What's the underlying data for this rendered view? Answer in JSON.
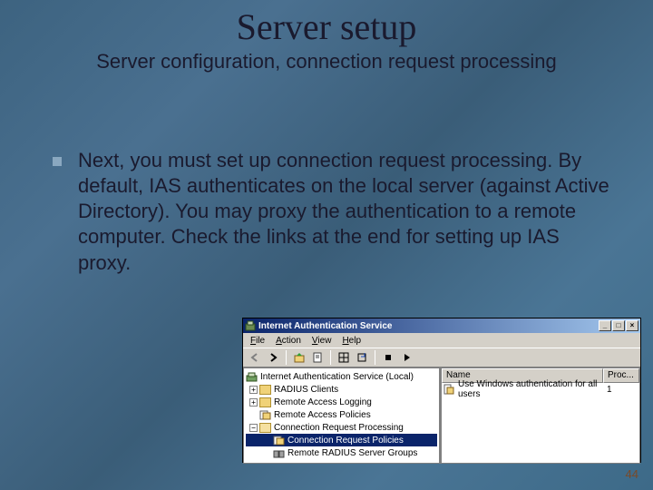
{
  "title": "Server setup",
  "subtitle": "Server configuration, connection request processing",
  "body_text": "Next, you must set up connection request processing. By default, IAS authenticates on the local server (against Active Directory). You may proxy the authentication to a remote computer. Check the links at the end for setting up IAS proxy.",
  "page_number": "44",
  "ias_window": {
    "title": "Internet Authentication Service",
    "menu": {
      "file": "File",
      "action": "Action",
      "view": "View",
      "help": "Help"
    },
    "tree": {
      "root": "Internet Authentication Service (Local)",
      "items": [
        "RADIUS Clients",
        "Remote Access Logging",
        "Remote Access Policies",
        "Connection Request Processing"
      ],
      "sub_items": [
        "Connection Request Policies",
        "Remote RADIUS Server Groups"
      ]
    },
    "list": {
      "col_name": "Name",
      "col_proc": "Proc...",
      "row_name": "Use Windows authentication for all users",
      "row_proc": "1"
    }
  }
}
